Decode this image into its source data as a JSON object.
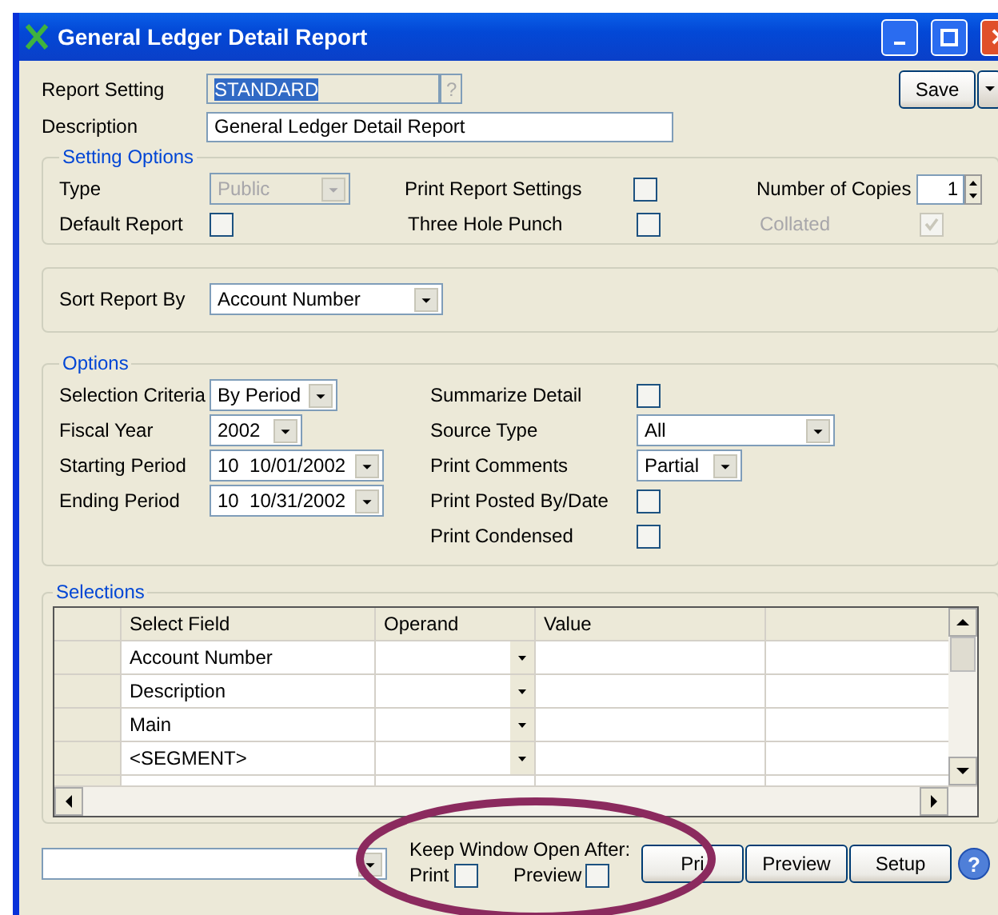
{
  "window": {
    "title": "General Ledger Detail Report"
  },
  "report_setting": {
    "label": "Report Setting",
    "value": "STANDARD",
    "help": "?"
  },
  "description": {
    "label": "Description",
    "value": "General Ledger Detail Report"
  },
  "save_button": "Save",
  "setting_options": {
    "legend": "Setting Options",
    "type": {
      "label": "Type",
      "value": "Public",
      "disabled": true
    },
    "default_report": {
      "label": "Default Report",
      "checked": false
    },
    "print_report_settings": {
      "label": "Print Report Settings",
      "checked": false
    },
    "three_hole_punch": {
      "label": "Three Hole Punch",
      "checked": false
    },
    "number_of_copies": {
      "label": "Number of Copies",
      "value": "1"
    },
    "collated": {
      "label": "Collated",
      "checked": true,
      "disabled": true
    }
  },
  "sort": {
    "label": "Sort Report By",
    "value": "Account Number"
  },
  "options": {
    "legend": "Options",
    "left": [
      {
        "label": "Selection Criteria",
        "value": "By Period"
      },
      {
        "label": "Fiscal Year",
        "value": "2002"
      },
      {
        "label": "Starting Period",
        "value": "10  10/01/2002"
      },
      {
        "label": "Ending Period",
        "value": "10  10/31/2002"
      }
    ],
    "right": [
      {
        "kind": "checkbox",
        "label": "Summarize Detail",
        "checked": false
      },
      {
        "kind": "combo",
        "label": "Source Type",
        "value": "All"
      },
      {
        "kind": "combo",
        "label": "Print Comments",
        "value": "Partial"
      },
      {
        "kind": "checkbox",
        "label": "Print Posted By/Date",
        "checked": false
      },
      {
        "kind": "checkbox",
        "label": "Print Condensed",
        "checked": false
      }
    ]
  },
  "selections": {
    "legend": "Selections",
    "columns": [
      "Select Field",
      "Operand",
      "Value"
    ],
    "rows": [
      {
        "select_field": "Account Number"
      },
      {
        "select_field": "Description"
      },
      {
        "select_field": "Main"
      },
      {
        "select_field": "<SEGMENT>"
      }
    ]
  },
  "keep_open": {
    "label": "Keep Window Open After:",
    "print": {
      "label": "Print",
      "checked": false
    },
    "preview": {
      "label": "Preview",
      "checked": false
    }
  },
  "buttons": [
    "Pri",
    "Preview",
    "Setup"
  ],
  "help_button": "?"
}
